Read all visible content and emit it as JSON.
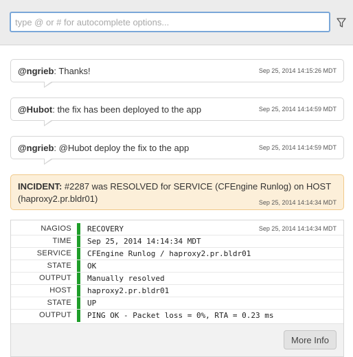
{
  "search": {
    "placeholder": "type @ or # for autocomplete options...",
    "value": ""
  },
  "toolbar": {
    "filter_icon": "filter-icon"
  },
  "messages": [
    {
      "user": "@ngrieb",
      "text": ": Thanks!",
      "timestamp": "Sep 25, 2014 14:15:26 MDT"
    },
    {
      "user": "@Hubot",
      "text": ": the fix has been deployed to the app",
      "timestamp": "Sep 25, 2014 14:14:59 MDT"
    },
    {
      "user": "@ngrieb",
      "text": ": @Hubot deploy the fix to the app",
      "timestamp": "Sep 25, 2014 14:14:59 MDT"
    }
  ],
  "incident": {
    "label": "INCIDENT:",
    "text": " #2287 was RESOLVED for SERVICE (CFEngine Runlog) on HOST (haproxy2.pr.bldr01)",
    "timestamp": "Sep 25, 2014 14:14:34 MDT"
  },
  "nagios": {
    "timestamp": "Sep 25, 2014 14:14:34 MDT",
    "status_color": "#1f9e2a",
    "rows": [
      {
        "key": "NAGIOS",
        "value": "RECOVERY"
      },
      {
        "key": "TIME",
        "value": "Sep 25, 2014 14:14:34 MDT"
      },
      {
        "key": "SERVICE",
        "value": "CFEngine Runlog / haproxy2.pr.bldr01"
      },
      {
        "key": "STATE",
        "value": "OK"
      },
      {
        "key": "OUTPUT",
        "value": "Manually resolved"
      },
      {
        "key": "HOST",
        "value": "haproxy2.pr.bldr01"
      },
      {
        "key": "STATE",
        "value": "UP"
      },
      {
        "key": "OUTPUT",
        "value": "PING OK - Packet loss = 0%, RTA = 0.23 ms"
      }
    ],
    "more_label": "More Info"
  }
}
